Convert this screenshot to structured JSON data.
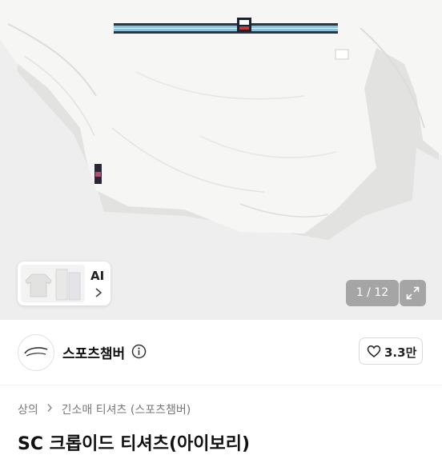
{
  "gallery": {
    "ai_label": "AI",
    "counter": "1 / 12"
  },
  "seller": {
    "name": "스포츠챔버",
    "like_count": "3.3만"
  },
  "breadcrumb": {
    "items": [
      "상의",
      "긴소매 티셔츠 (스포츠챔버)"
    ]
  },
  "product": {
    "title": "SC 크롭이드 티셔츠(아이보리)"
  },
  "icons": {
    "info": "info-icon",
    "heart": "heart-icon",
    "expand": "expand-icon",
    "chevron": "chevron-right-icon"
  },
  "colors": {
    "background": "#eeeeee",
    "shirt": "#f6f6f4",
    "stripe": "#8fc1da",
    "counter_bg": "#8c8c8c"
  }
}
